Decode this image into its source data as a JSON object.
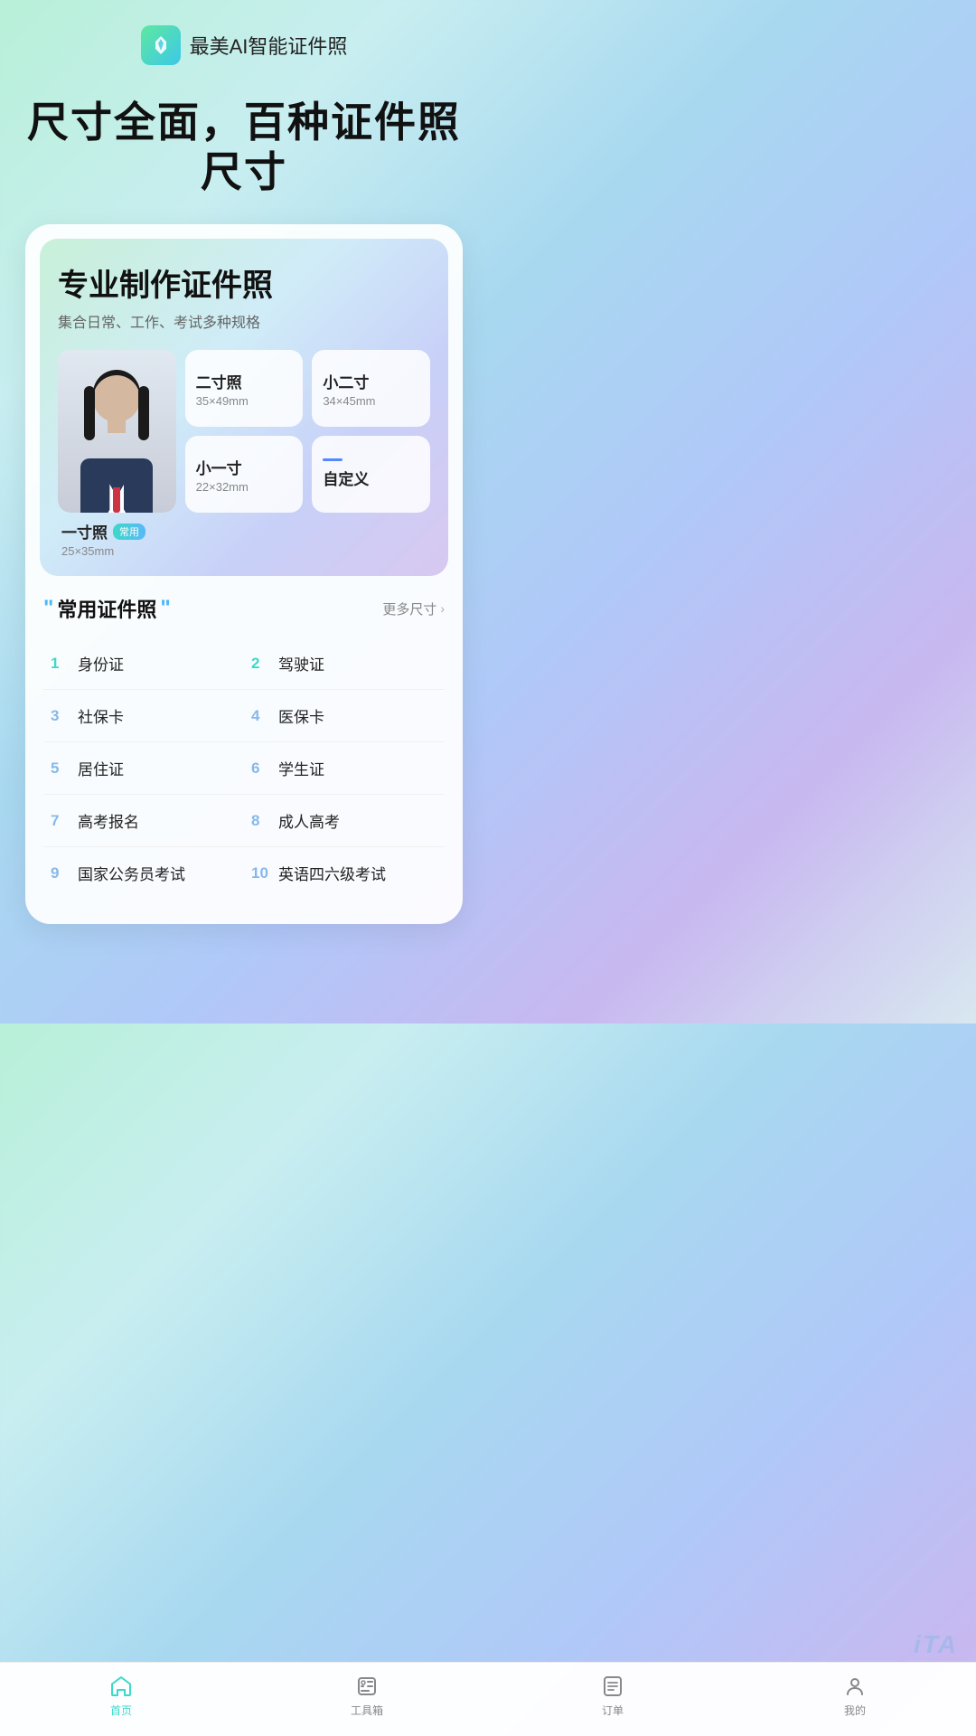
{
  "header": {
    "app_icon_text": "Y",
    "app_name": "最美AI智能证件照"
  },
  "hero": {
    "title": "尺寸全面，百种证件照尺寸"
  },
  "card": {
    "title": "专业制作证件照",
    "subtitle": "集合日常、工作、考试多种规格",
    "photo_sizes": [
      {
        "name": "一寸照",
        "tag": "常用",
        "size": "25×35mm",
        "type": "portrait"
      },
      {
        "name": "二寸照",
        "size": "35×49mm"
      },
      {
        "name": "小二寸",
        "size": "34×45mm"
      },
      {
        "name": "小一寸",
        "size": "22×32mm"
      },
      {
        "name": "自定义",
        "size": ""
      }
    ],
    "common_section": {
      "title": "常用证件照",
      "more_label": "更多尺寸",
      "items": [
        {
          "number": "1",
          "label": "身份证",
          "color_class": "n1"
        },
        {
          "number": "2",
          "label": "驾驶证",
          "color_class": "n2"
        },
        {
          "number": "3",
          "label": "社保卡",
          "color_class": "n3"
        },
        {
          "number": "4",
          "label": "医保卡",
          "color_class": "n4"
        },
        {
          "number": "5",
          "label": "居住证",
          "color_class": "n5"
        },
        {
          "number": "6",
          "label": "学生证",
          "color_class": "n6"
        },
        {
          "number": "7",
          "label": "高考报名",
          "color_class": "n7"
        },
        {
          "number": "8",
          "label": "成人高考",
          "color_class": "n8"
        },
        {
          "number": "9",
          "label": "国家公务员考试",
          "color_class": "n9"
        },
        {
          "number": "10",
          "label": "英语四六级考试",
          "color_class": "n10"
        }
      ]
    }
  },
  "nav": {
    "items": [
      {
        "id": "home",
        "label": "首页",
        "active": true
      },
      {
        "id": "tools",
        "label": "工具箱",
        "active": false
      },
      {
        "id": "orders",
        "label": "订单",
        "active": false
      },
      {
        "id": "mine",
        "label": "我的",
        "active": false
      }
    ]
  },
  "watermark": "iTA"
}
